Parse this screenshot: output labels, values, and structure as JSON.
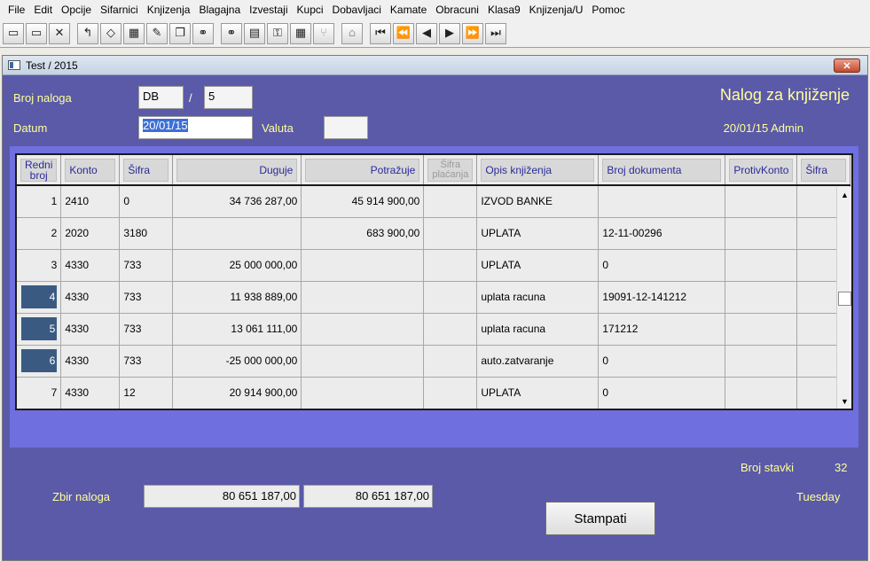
{
  "menu": [
    "File",
    "Edit",
    "Opcije",
    "Sifarnici",
    "Knjizenja",
    "Blagajna",
    "Izvestaji",
    "Kupci",
    "Dobavljaci",
    "Kamate",
    "Obracuni",
    "Klasa9",
    "Knjizenja/U",
    "Pomoc"
  ],
  "toolbar": {
    "buttons": [
      {
        "name": "open-folder-icon",
        "glyph": "▭"
      },
      {
        "name": "open-file-icon",
        "glyph": "▭"
      },
      {
        "name": "tools-icon",
        "glyph": "✕"
      },
      {
        "name": "undo-icon",
        "glyph": "↰"
      },
      {
        "name": "diamond-icon",
        "glyph": "◇"
      },
      {
        "name": "grid-icon",
        "glyph": "▦"
      },
      {
        "name": "edit-icon",
        "glyph": "✎"
      },
      {
        "name": "copy-icon",
        "glyph": "❐"
      },
      {
        "name": "binoculars-icon",
        "glyph": "⚭"
      },
      {
        "name": "binoculars-plus-icon",
        "glyph": "⚭"
      },
      {
        "name": "panel-icon",
        "glyph": "▤"
      },
      {
        "name": "key-icon",
        "glyph": "⚿"
      },
      {
        "name": "calculator-icon",
        "glyph": "▦"
      },
      {
        "name": "branch-icon",
        "glyph": "⑂",
        "disabled": true
      },
      {
        "name": "stamp-icon",
        "glyph": "⌂",
        "disabled": true
      },
      {
        "name": "first-record-icon",
        "glyph": "⏮"
      },
      {
        "name": "prev-page-icon",
        "glyph": "⏪"
      },
      {
        "name": "prev-record-icon",
        "glyph": "◀"
      },
      {
        "name": "next-record-icon",
        "glyph": "▶"
      },
      {
        "name": "next-page-icon",
        "glyph": "⏩"
      },
      {
        "name": "last-record-icon",
        "glyph": "⏭"
      }
    ]
  },
  "window": {
    "title": "Test / 2015",
    "close": "✕"
  },
  "form": {
    "broj_naloga_label": "Broj naloga",
    "broj_naloga_type": "DB",
    "slash": "/",
    "broj_naloga_num": "5",
    "datum_label": "Datum",
    "datum_value": "20/01/15",
    "valuta_label": "Valuta",
    "valuta_value": "",
    "heading": "Nalog za knjiženje",
    "date_user": "20/01/15 Admin"
  },
  "grid": {
    "columns": [
      {
        "label": "Redni broj",
        "align": "c"
      },
      {
        "label": "Konto",
        "align": "l"
      },
      {
        "label": "Šifra",
        "align": "l"
      },
      {
        "label": "Duguje",
        "align": "r"
      },
      {
        "label": "Potražuje",
        "align": "r"
      },
      {
        "label": "Šifra plaćanja",
        "align": "dim"
      },
      {
        "label": "Opis knjiženja",
        "align": "l"
      },
      {
        "label": "Broj dokumenta",
        "align": "l"
      },
      {
        "label": "ProtivKonto",
        "align": "l"
      },
      {
        "label": "Šifra",
        "align": "l"
      }
    ],
    "rows": [
      {
        "rb": "1",
        "konto": "2410",
        "sifra": "0",
        "duguje": "34 736 287,00",
        "potrazuje": "45 914 900,00",
        "sifra_placanja": "",
        "opis": "IZVOD BANKE",
        "broj_dok": "",
        "protivkonto": "",
        "sifra2": "",
        "selected": false
      },
      {
        "rb": "2",
        "konto": "2020",
        "sifra": "3180",
        "duguje": "",
        "potrazuje": "683 900,00",
        "sifra_placanja": "",
        "opis": "UPLATA",
        "broj_dok": "12-11-00296",
        "protivkonto": "",
        "sifra2": "",
        "selected": false
      },
      {
        "rb": "3",
        "konto": "4330",
        "sifra": "733",
        "duguje": "25 000 000,00",
        "potrazuje": "",
        "sifra_placanja": "",
        "opis": "UPLATA",
        "broj_dok": "0",
        "protivkonto": "",
        "sifra2": "",
        "selected": false
      },
      {
        "rb": "4",
        "konto": "4330",
        "sifra": "733",
        "duguje": "11 938 889,00",
        "potrazuje": "",
        "sifra_placanja": "",
        "opis": "uplata racuna",
        "broj_dok": "19091-12-141212",
        "protivkonto": "",
        "sifra2": "",
        "selected": true
      },
      {
        "rb": "5",
        "konto": "4330",
        "sifra": "733",
        "duguje": "13 061 111,00",
        "potrazuje": "",
        "sifra_placanja": "",
        "opis": "uplata racuna",
        "broj_dok": "171212",
        "protivkonto": "",
        "sifra2": "",
        "selected": true
      },
      {
        "rb": "6",
        "konto": "4330",
        "sifra": "733",
        "duguje": "-25 000 000,00",
        "potrazuje": "",
        "sifra_placanja": "",
        "opis": "auto.zatvaranje",
        "broj_dok": "0",
        "protivkonto": "",
        "sifra2": "",
        "selected": true
      },
      {
        "rb": "7",
        "konto": "4330",
        "sifra": "12",
        "duguje": "20 914 900,00",
        "potrazuje": "",
        "sifra_placanja": "",
        "opis": "UPLATA",
        "broj_dok": "0",
        "protivkonto": "",
        "sifra2": "",
        "selected": false
      }
    ],
    "scroll_up": "▲",
    "scroll_down": "▼"
  },
  "footer": {
    "broj_stavki_label": "Broj stavki",
    "broj_stavki_value": "32",
    "zbir_label": "Zbir naloga",
    "zbir_duguje": "80 651 187,00",
    "zbir_potrazuje": "80 651 187,00",
    "day": "Tuesday",
    "print_button": "Stampati"
  }
}
